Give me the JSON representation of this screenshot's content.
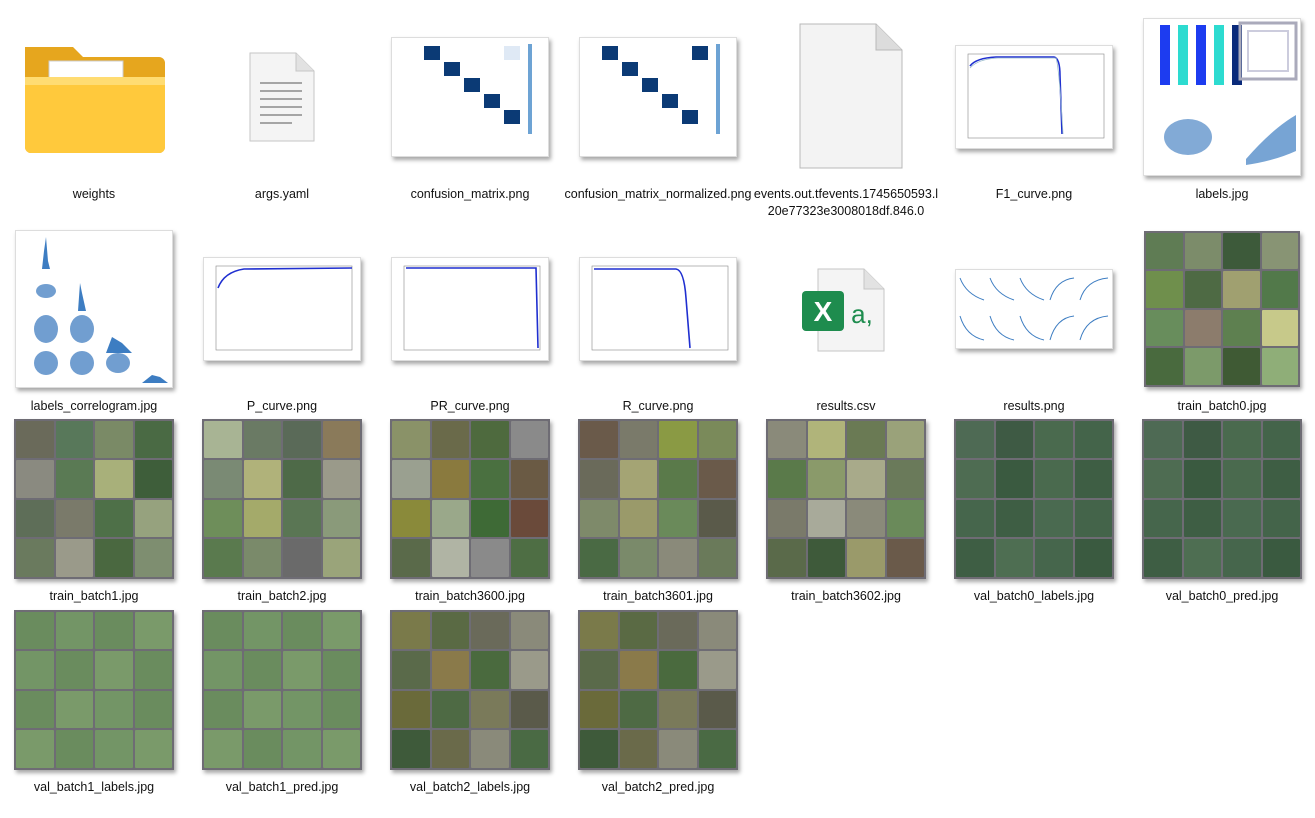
{
  "files": [
    {
      "name": "weights",
      "kind": "folder-icon"
    },
    {
      "name": "args.yaml",
      "kind": "document-icon"
    },
    {
      "name": "confusion_matrix.png",
      "kind": "confusion-thumb"
    },
    {
      "name": "confusion_matrix_normalized.png",
      "kind": "confusion-thumb"
    },
    {
      "name": "events.out.tfevents.1745650593.l20e77323e3008018df.846.0",
      "kind": "blank-file-icon"
    },
    {
      "name": "F1_curve.png",
      "kind": "curve-thumb"
    },
    {
      "name": "labels.jpg",
      "kind": "labels-thumb"
    },
    {
      "name": "labels_correlogram.jpg",
      "kind": "correlogram-thumb"
    },
    {
      "name": "P_curve.png",
      "kind": "curve-thumb"
    },
    {
      "name": "PR_curve.png",
      "kind": "curve-thumb"
    },
    {
      "name": "R_curve.png",
      "kind": "curve-thumb"
    },
    {
      "name": "results.csv",
      "kind": "excel-icon"
    },
    {
      "name": "results.png",
      "kind": "results-thumb"
    },
    {
      "name": "train_batch0.jpg",
      "kind": "batch-thumb"
    },
    {
      "name": "train_batch1.jpg",
      "kind": "batch-thumb"
    },
    {
      "name": "train_batch2.jpg",
      "kind": "batch-thumb"
    },
    {
      "name": "train_batch3600.jpg",
      "kind": "batch-thumb"
    },
    {
      "name": "train_batch3601.jpg",
      "kind": "batch-thumb"
    },
    {
      "name": "train_batch3602.jpg",
      "kind": "batch-thumb"
    },
    {
      "name": "val_batch0_labels.jpg",
      "kind": "batch-thumb"
    },
    {
      "name": "val_batch0_pred.jpg",
      "kind": "batch-thumb"
    },
    {
      "name": "val_batch1_labels.jpg",
      "kind": "batch-thumb"
    },
    {
      "name": "val_batch1_pred.jpg",
      "kind": "batch-thumb"
    },
    {
      "name": "val_batch2_labels.jpg",
      "kind": "batch-thumb"
    },
    {
      "name": "val_batch2_pred.jpg",
      "kind": "batch-thumb"
    }
  ],
  "colors": {
    "folder": "#f5c242",
    "folder_front": "#ffd866",
    "excel_green": "#1e8c4e",
    "matrix_blue": "#0b3a75",
    "curve_blue": "#1f2fd0",
    "leaf_green": "#3f7a3a"
  }
}
